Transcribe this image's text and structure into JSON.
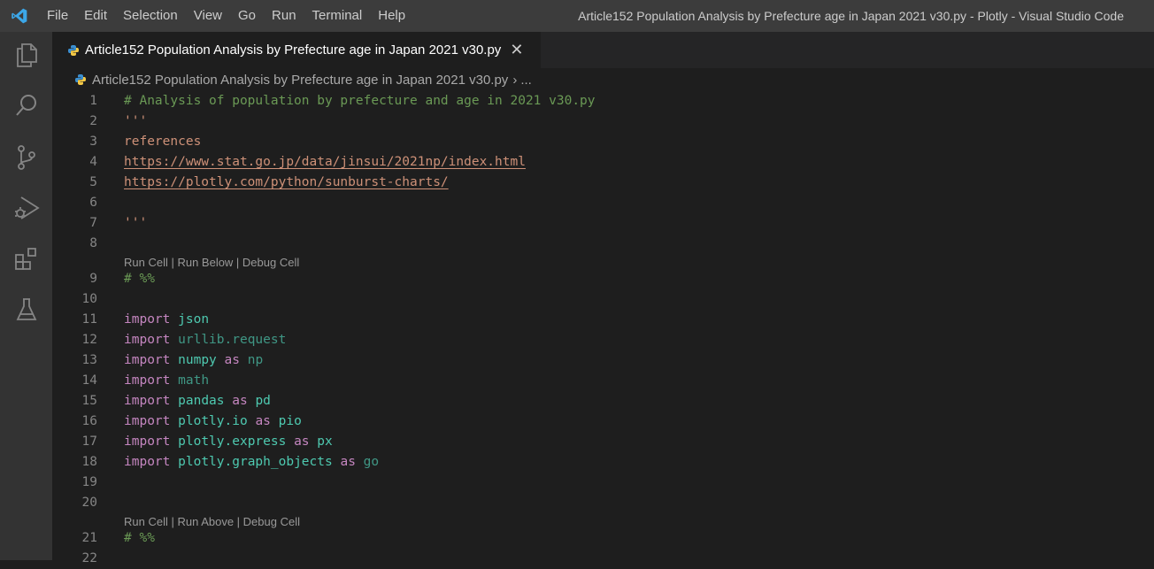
{
  "menu": [
    "File",
    "Edit",
    "Selection",
    "View",
    "Go",
    "Run",
    "Terminal",
    "Help"
  ],
  "window_title": "Article152 Population Analysis by Prefecture age in Japan 2021 v30.py - Plotly - Visual Studio Code",
  "activity_icons": [
    "explorer-icon",
    "search-icon",
    "source-control-icon",
    "run-debug-icon",
    "extensions-icon",
    "testing-icon"
  ],
  "tab": {
    "label": "Article152 Population Analysis by Prefecture age in Japan 2021 v30.py",
    "close": "✕"
  },
  "breadcrumb": {
    "file": "Article152 Population Analysis by Prefecture age in Japan 2021 v30.py",
    "sep": "›",
    "more": "..."
  },
  "codelens": {
    "cell1": "Run Cell | Run Below | Debug Cell",
    "cell2": "Run Cell | Run Above | Debug Cell"
  },
  "lines": [
    {
      "n": "1",
      "text": "# Analysis of population by prefecture and age in 2021 v30.py"
    },
    {
      "n": "2",
      "text": "'''"
    },
    {
      "n": "3",
      "text": "references"
    },
    {
      "n": "4",
      "text": "https://www.stat.go.jp/data/jinsui/2021np/index.html"
    },
    {
      "n": "5",
      "text": "https://plotly.com/python/sunburst-charts/"
    },
    {
      "n": "6",
      "text": ""
    },
    {
      "n": "7",
      "text": "'''"
    },
    {
      "n": "8",
      "text": ""
    },
    {
      "n": "9",
      "text": "# %%"
    },
    {
      "n": "10",
      "text": ""
    },
    {
      "n": "11",
      "kw": "import",
      "mod": "json"
    },
    {
      "n": "12",
      "kw": "import",
      "mod": "urllib.request"
    },
    {
      "n": "13",
      "kw": "import",
      "mod": "numpy",
      "as": "as",
      "alias": "np"
    },
    {
      "n": "14",
      "kw": "import",
      "mod": "math"
    },
    {
      "n": "15",
      "kw": "import",
      "mod": "pandas",
      "as": "as",
      "alias": "pd"
    },
    {
      "n": "16",
      "kw": "import",
      "mod": "plotly.io",
      "as": "as",
      "alias": "pio"
    },
    {
      "n": "17",
      "kw": "import",
      "mod": "plotly.express",
      "as": "as",
      "alias": "px"
    },
    {
      "n": "18",
      "kw": "import",
      "mod": "plotly.graph_objects",
      "as": "as",
      "alias": "go"
    },
    {
      "n": "19",
      "text": ""
    },
    {
      "n": "20",
      "text": ""
    },
    {
      "n": "21",
      "text": "# %%"
    },
    {
      "n": "22",
      "text": ""
    }
  ]
}
